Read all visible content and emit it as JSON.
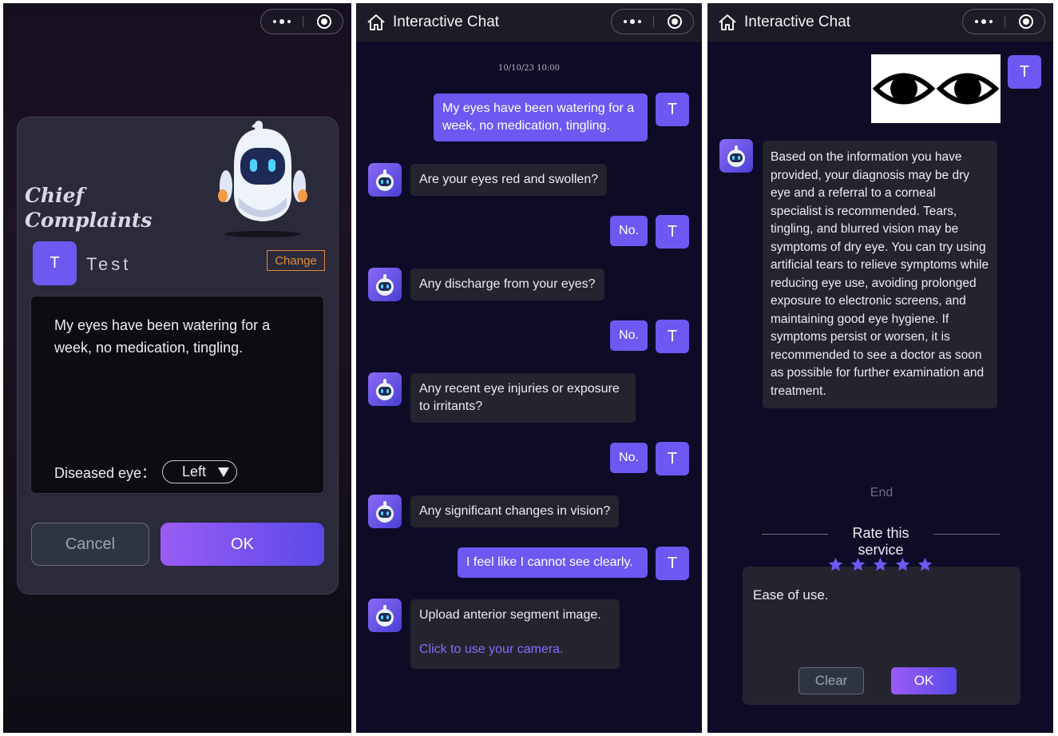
{
  "panel1": {
    "title_line1": "Chief",
    "title_line2": "Complaints",
    "user_initial": "T",
    "user_name": "Test",
    "change_label": "Change",
    "complaint_text": "My eyes have been watering for a week, no medication, tingling.",
    "diseased_eye_label": "Diseased eye：",
    "diseased_eye_value": "Left",
    "cancel_label": "Cancel",
    "ok_label": "OK"
  },
  "chat": {
    "title": "Interactive Chat",
    "timestamp": "10/10/23 10:00",
    "user_initial": "T",
    "messages": [
      {
        "from": "user",
        "text": "My eyes have been watering for a week, no medication, tingling."
      },
      {
        "from": "bot",
        "text": "Are your eyes red and swollen?"
      },
      {
        "from": "user",
        "text": "No."
      },
      {
        "from": "bot",
        "text": "Any discharge from your eyes?"
      },
      {
        "from": "user",
        "text": "No."
      },
      {
        "from": "bot",
        "text": "Any recent eye injuries or exposure to irritants?"
      },
      {
        "from": "user",
        "text": "No."
      },
      {
        "from": "bot",
        "text": "Any significant changes in vision?"
      },
      {
        "from": "user",
        "text": "I feel like I cannot see clearly."
      },
      {
        "from": "bot",
        "text": "Upload anterior segment image.",
        "link": "Click to use your camera."
      }
    ]
  },
  "result": {
    "title": "Interactive Chat",
    "user_initial": "T",
    "diagnosis": "Based on the information you have provided, your diagnosis may be dry eye and a referral to a corneal specialist is recommended. Tears, tingling, and blurred vision may be symptoms of dry eye. You can try using artificial tears to relieve symptoms while reducing eye use, avoiding prolonged exposure to electronic screens, and maintaining good eye hygiene. If symptoms persist or worsen, it is recommended to see a doctor as soon as possible for further examination and treatment.",
    "end_label": "End",
    "rate_title": "Rate this service",
    "rating": 5,
    "rating_max": 5,
    "feedback_text": "Ease of use.",
    "clear_label": "Clear",
    "ok_label": "OK"
  },
  "colors": {
    "accent": "#6d58f2",
    "link": "#8a6bff",
    "change": "#e38a42",
    "background": "#0d0b26",
    "bubble_bot": "#24242e"
  },
  "icons": [
    "home-icon",
    "more-dots-icon",
    "record-icon",
    "robot-icon",
    "dropdown-triangle-icon",
    "star-icon",
    "eyes-image"
  ]
}
